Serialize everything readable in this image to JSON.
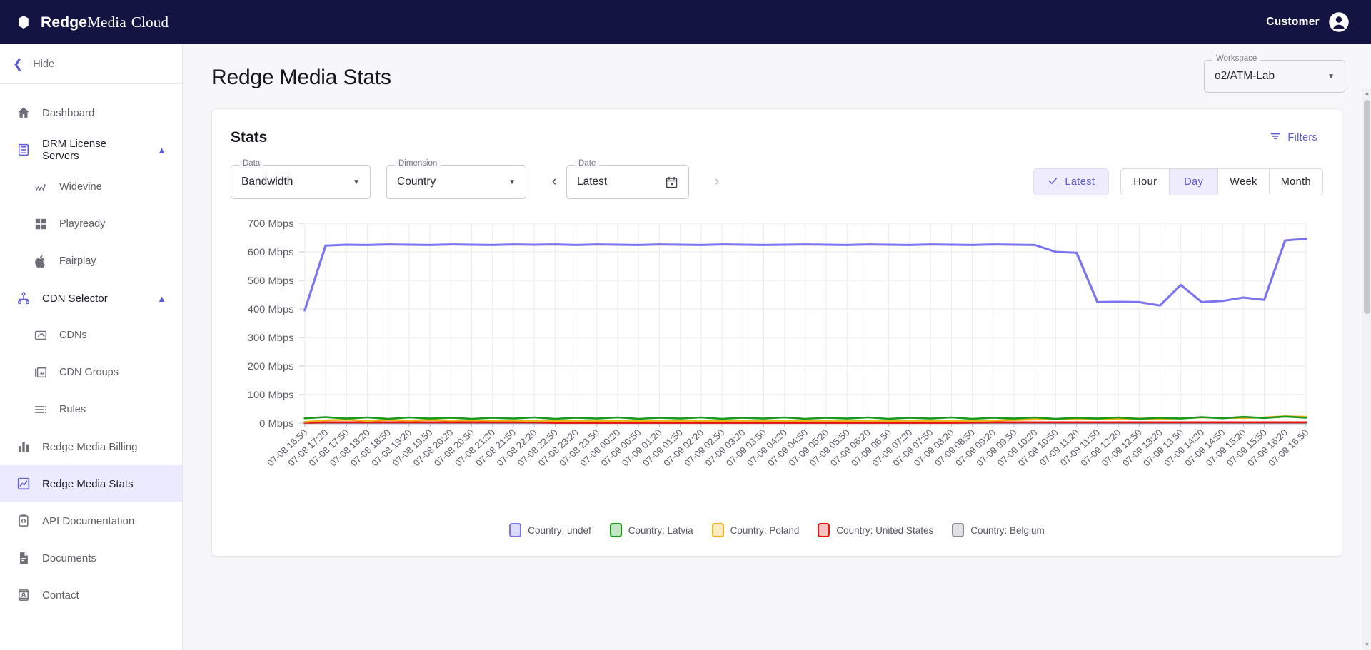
{
  "topbar": {
    "brand_bold": "Redge",
    "brand_media": "Media",
    "brand_cloud": "Cloud",
    "customer_label": "Customer"
  },
  "sidebar": {
    "hide_label": "Hide",
    "items": [
      {
        "label": "Dashboard",
        "icon": "home-icon",
        "level": 1,
        "active": false,
        "expandable": false
      },
      {
        "label": "DRM License Servers",
        "icon": "server-icon",
        "level": 1,
        "active": false,
        "expandable": true
      },
      {
        "label": "Widevine",
        "icon": "widevine-icon",
        "level": 2,
        "active": false,
        "expandable": false
      },
      {
        "label": "Playready",
        "icon": "playready-icon",
        "level": 2,
        "active": false,
        "expandable": false
      },
      {
        "label": "Fairplay",
        "icon": "apple-icon",
        "level": 2,
        "active": false,
        "expandable": false
      },
      {
        "label": "CDN Selector",
        "icon": "sitemap-icon",
        "level": 1,
        "active": false,
        "expandable": true
      },
      {
        "label": "CDNs",
        "icon": "cloud-box-icon",
        "level": 2,
        "active": false,
        "expandable": false
      },
      {
        "label": "CDN Groups",
        "icon": "folders-icon",
        "level": 2,
        "active": false,
        "expandable": false
      },
      {
        "label": "Rules",
        "icon": "rules-list-icon",
        "level": 2,
        "active": false,
        "expandable": false
      },
      {
        "label": "Redge Media Billing",
        "icon": "bar-chart-icon",
        "level": 1,
        "active": false,
        "expandable": false
      },
      {
        "label": "Redge Media Stats",
        "icon": "line-chart-icon",
        "level": 1,
        "active": true,
        "expandable": false
      },
      {
        "label": "API Documentation",
        "icon": "code-doc-icon",
        "level": 1,
        "active": false,
        "expandable": false
      },
      {
        "label": "Documents",
        "icon": "document-icon",
        "level": 1,
        "active": false,
        "expandable": false
      },
      {
        "label": "Contact",
        "icon": "contact-card-icon",
        "level": 1,
        "active": false,
        "expandable": false
      }
    ]
  },
  "page": {
    "title": "Redge Media Stats",
    "workspace": {
      "legend": "Workspace",
      "value": "o2/ATM-Lab"
    }
  },
  "card": {
    "title": "Stats",
    "filters_label": "Filters",
    "controls": {
      "data": {
        "legend": "Data",
        "value": "Bandwidth"
      },
      "dimension": {
        "legend": "Dimension",
        "value": "Country"
      },
      "date": {
        "legend": "Date",
        "value": "Latest"
      },
      "prev_label": "‹",
      "next_label": "›"
    },
    "range": {
      "latest_label": "Latest",
      "latest_selected": true,
      "options": [
        {
          "label": "Hour",
          "selected": false
        },
        {
          "label": "Day",
          "selected": true
        },
        {
          "label": "Week",
          "selected": false
        },
        {
          "label": "Month",
          "selected": false
        }
      ]
    }
  },
  "colors": {
    "brand_navy": "#131442",
    "accent_purple": "#5b5bd6",
    "series_undef": "#7b74f0",
    "series_latvia": "#1a9a1a",
    "series_poland": "#efb412",
    "series_us": "#ee1111",
    "series_belgium": "#8d8d95"
  },
  "chart_data": {
    "type": "line",
    "title": "",
    "xlabel": "",
    "ylabel": "",
    "ylim": [
      0,
      700
    ],
    "yunit": "Mbps",
    "ytick_labels": [
      "0 Mbps",
      "100 Mbps",
      "200 Mbps",
      "300 Mbps",
      "400 Mbps",
      "500 Mbps",
      "600 Mbps",
      "700 Mbps"
    ],
    "ytick_values": [
      0,
      100,
      200,
      300,
      400,
      500,
      600,
      700
    ],
    "grid": true,
    "legend_position": "bottom",
    "x_tick_interval_minutes": 30,
    "x_first": "07-08 16:50",
    "x_last": "07-09 16:50",
    "xtick_labels": [
      "07-08 16:50",
      "07-08 17:20",
      "07-08 17:50",
      "07-08 18:20",
      "07-08 18:50",
      "07-08 19:20",
      "07-08 19:50",
      "07-08 20:20",
      "07-08 20:50",
      "07-08 21:20",
      "07-08 21:50",
      "07-08 22:20",
      "07-08 22:50",
      "07-08 23:20",
      "07-08 23:50",
      "07-09 00:20",
      "07-09 00:50",
      "07-09 01:20",
      "07-09 01:50",
      "07-09 02:20",
      "07-09 02:50",
      "07-09 03:20",
      "07-09 03:50",
      "07-09 04:20",
      "07-09 04:50",
      "07-09 05:20",
      "07-09 05:50",
      "07-09 06:20",
      "07-09 06:50",
      "07-09 07:20",
      "07-09 07:50",
      "07-09 08:20",
      "07-09 08:50",
      "07-09 09:20",
      "07-09 09:50",
      "07-09 10:20",
      "07-09 10:50",
      "07-09 11:20",
      "07-09 11:50",
      "07-09 12:20",
      "07-09 12:50",
      "07-09 13:20",
      "07-09 13:50",
      "07-09 14:20",
      "07-09 14:50",
      "07-09 15:20",
      "07-09 15:50",
      "07-09 16:20",
      "07-09 16:50"
    ],
    "series": [
      {
        "name": "Country: undef",
        "legend_label": "Country: undef",
        "color": "#7b74f0",
        "values": [
          395,
          622,
          625,
          624,
          626,
          625,
          624,
          626,
          625,
          624,
          626,
          625,
          626,
          624,
          626,
          625,
          624,
          626,
          625,
          624,
          626,
          625,
          624,
          625,
          626,
          625,
          624,
          626,
          625,
          624,
          626,
          625,
          624,
          626,
          625,
          624,
          600,
          597,
          424,
          425,
          424,
          412,
          484,
          424,
          428,
          440,
          432,
          640,
          646
        ]
      },
      {
        "name": "Country: Latvia",
        "legend_label": "Country: Latvia",
        "color": "#1a9a1a",
        "values": [
          17,
          21,
          16,
          20,
          15,
          20,
          16,
          19,
          15,
          19,
          16,
          20,
          15,
          19,
          16,
          20,
          15,
          19,
          16,
          20,
          15,
          19,
          16,
          20,
          15,
          19,
          16,
          20,
          15,
          19,
          16,
          20,
          15,
          19,
          16,
          20,
          15,
          19,
          16,
          20,
          15,
          19,
          16,
          21,
          17,
          22,
          18,
          23,
          19
        ]
      },
      {
        "name": "Country: Poland",
        "legend_label": "Country: Poland",
        "color": "#efb412",
        "values": [
          4,
          10,
          12,
          8,
          11,
          9,
          11,
          9,
          10,
          9,
          9,
          8,
          7,
          7,
          7,
          7,
          7,
          7,
          7,
          7,
          7,
          7,
          7,
          7,
          7,
          7,
          7,
          7,
          7,
          7,
          7,
          7,
          8,
          9,
          11,
          13,
          14,
          13,
          14,
          15,
          16,
          15,
          17,
          20,
          19,
          18,
          20,
          24,
          22
        ]
      },
      {
        "name": "Country: United States",
        "legend_label": "Country: United States",
        "color": "#ee1111",
        "values": [
          1,
          3,
          3,
          3,
          3,
          3,
          3,
          3,
          3,
          3,
          3,
          3,
          1,
          1,
          1,
          1,
          1,
          1,
          1,
          1,
          1,
          1,
          1,
          1,
          1,
          1,
          1,
          1,
          1,
          1,
          1,
          1,
          2,
          3,
          3,
          3,
          3,
          3,
          3,
          3,
          3,
          3,
          3,
          3,
          3,
          3,
          3,
          3,
          3
        ]
      },
      {
        "name": "Country: Belgium",
        "legend_label": "Country: Belgium",
        "color": "#8d8d95",
        "values": [
          0,
          0,
          0,
          0,
          0,
          0,
          0,
          0,
          0,
          0,
          0,
          0,
          0,
          0,
          0,
          0,
          0,
          0,
          0,
          0,
          0,
          0,
          0,
          0,
          0,
          0,
          0,
          0,
          0,
          0,
          0,
          0,
          0,
          0,
          0,
          0,
          0,
          0,
          0,
          0,
          0,
          0,
          0,
          0,
          0,
          0,
          0,
          0,
          0
        ]
      }
    ]
  }
}
